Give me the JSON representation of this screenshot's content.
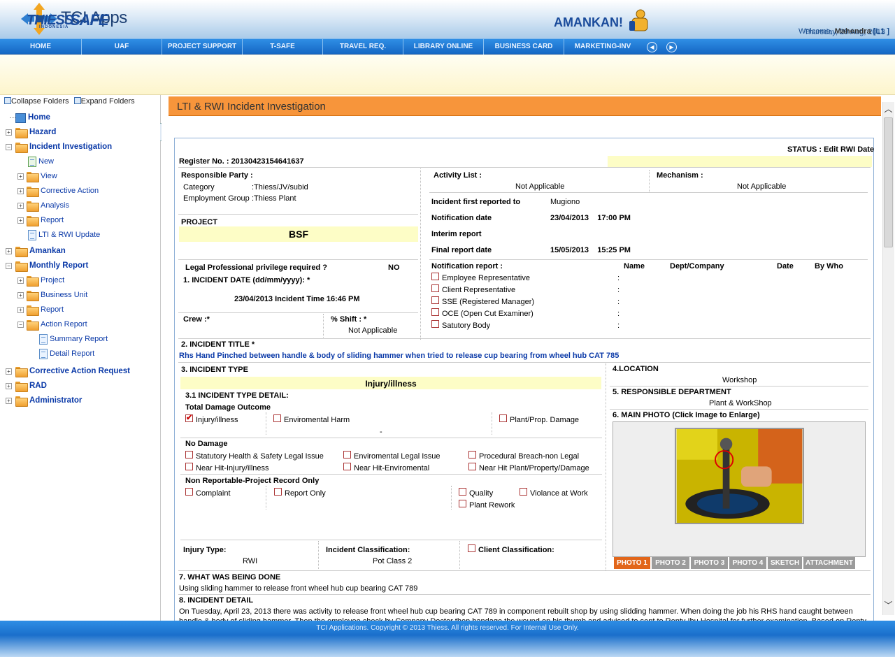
{
  "header": {
    "app_title": "TCI Apps",
    "date": "Thursday, 29 Aug, 2013",
    "nav": [
      "HOME",
      "UAF",
      "PROJECT SUPPORT",
      "T-SAFE",
      "TRAVEL REQ.",
      "LIBRARY ONLINE",
      "BUSINESS CARD",
      "MARKETING-INV"
    ],
    "brand_left": "THIESS",
    "brand_right": "SAFE",
    "brand_sub": "INDONESIA",
    "slogan": "AMANKAN!",
    "welcome_prefix": "Welcome, ",
    "welcome_user": "Mahendra",
    "welcome_level": "[L1 ]"
  },
  "sidebar": {
    "collapse": "Collapse Folders",
    "expand": "Expand Folders",
    "items": [
      {
        "label": "Home"
      },
      {
        "label": "Hazard"
      },
      {
        "label": "Incident Investigation"
      },
      {
        "label": "New"
      },
      {
        "label": "View"
      },
      {
        "label": "Corrective Action"
      },
      {
        "label": "Analysis"
      },
      {
        "label": "Report"
      },
      {
        "label": "LTI & RWI Update"
      },
      {
        "label": "Amankan"
      },
      {
        "label": "Monthly Report"
      },
      {
        "label": "Project"
      },
      {
        "label": "Business Unit"
      },
      {
        "label": "Report"
      },
      {
        "label": "Action Report"
      },
      {
        "label": "Summary Report"
      },
      {
        "label": "Detail Report"
      },
      {
        "label": "Corrective Action Request"
      },
      {
        "label": "RAD"
      },
      {
        "label": "Administrator"
      }
    ]
  },
  "page": {
    "title": "LTI & RWI Incident Investigation",
    "status": "STATUS : Edit RWI Date",
    "register": "Register No. : 20130423154641637",
    "responsible_party": "Responsible Party :",
    "category_label": "Category",
    "category_value": ":Thiess/JV/subid",
    "employment_label": "Employment Group",
    "employment_value": ":Thiess Plant",
    "project_label": "PROJECT",
    "project_value": "BSF",
    "legal_label": "Legal Professional privilege required ?",
    "legal_value": "NO",
    "incident_date_label": "1. INCIDENT DATE (dd/mm/yyyy): *",
    "incident_date_value": "23/04/2013 Incident Time  16:46 PM",
    "crew_label": "Crew :*",
    "shift_label": "% Shift : *",
    "shift_value": "Not Applicable",
    "activity_label": "Activity List :",
    "activity_value": "Not Applicable",
    "mechanism_label": "Mechanism :",
    "mechanism_value": "Not Applicable",
    "first_reported_label": "Incident first reported to",
    "first_reported_value": "Mugiono",
    "notification_date_label": "Notification date",
    "notification_date_value": "23/04/2013    17:00 PM",
    "interim_label": "Interim report",
    "final_label": "Final report date",
    "final_value": "15/05/2013    15:25 PM",
    "notif_report_label": "Notification report :",
    "notif_cols": [
      "Name",
      "Dept/Company",
      "Date",
      "By Who"
    ],
    "notif_rows": [
      "Employee Representative",
      "Client Representative",
      "SSE (Registered Manager)",
      "OCE (Open Cut Examiner)",
      "Satutory Body"
    ],
    "colon": ":",
    "title_label": "2. INCIDENT TITLE *",
    "title_value": "Rhs Hand Pinched between handle & body of sliding hammer when tried to release cup bearing from wheel hub CAT 785",
    "type_label": "3. INCIDENT TYPE",
    "type_value": "Injury/illness",
    "type_detail_label": "3.1 INCIDENT TYPE DETAIL:",
    "total_damage_label": "Total Damage Outcome",
    "td_injury": "Injury/illness",
    "td_env": "Enviromental Harm",
    "td_plant": "Plant/Prop. Damage",
    "dash": "-",
    "no_damage_label": "No Damage",
    "nd_items": [
      "Statutory Health & Safety Legal Issue",
      "Enviromental Legal Issue",
      "Procedural Breach-non Legal",
      "Near Hit-Injury/illness",
      "Near Hit-Enviromental",
      "Near Hit Plant/Property/Damage"
    ],
    "nr_label": "Non Reportable-Project Record Only",
    "nr_items": [
      "Complaint",
      "Report Only",
      "Quality",
      "Violance at Work",
      "Plant Rework"
    ],
    "injury_type_label": "Injury Type:",
    "injury_type_value": "RWI",
    "classification_label": "Incident Classification:",
    "classification_value": "Pot Class 2",
    "client_class_label": "Client Classification:",
    "location_label": "4.LOCATION",
    "location_value": "Workshop",
    "dept_label": "5. RESPONSIBLE DEPARTMENT",
    "dept_value": "Plant & WorkShop",
    "photo_label": "6. MAIN PHOTO (Click Image to Enlarge)",
    "photo_tabs": [
      "PHOTO 1",
      "PHOTO 2",
      "PHOTO 3",
      "PHOTO 4",
      "SKETCH",
      "ATTACHMENT"
    ],
    "doing_label": "7. WHAT WAS BEING DONE",
    "doing_value": "Using sliding hammer to release front wheel hub cup bearing CAT 789",
    "detail_label": "8. INCIDENT DETAIL",
    "detail_line1": "On Tuesday, April 23, 2013 there was activity to release front wheel hub cup bearing CAT 789 in component rebuilt shop by using slidding hammer. When doing the job his RHS hand caught between",
    "detail_line2": "handle & body of sliding hammer. Then the employee check by Company Doctor then bandage the wound on his thumb and advised to sent to Renty Ibu Hospital for further examination. Based on Renty Ibu"
  },
  "footer": {
    "copyright": "TCI Applications. Copyright © 2013 Thiess. All rights reserved. For Internal Use Only."
  }
}
